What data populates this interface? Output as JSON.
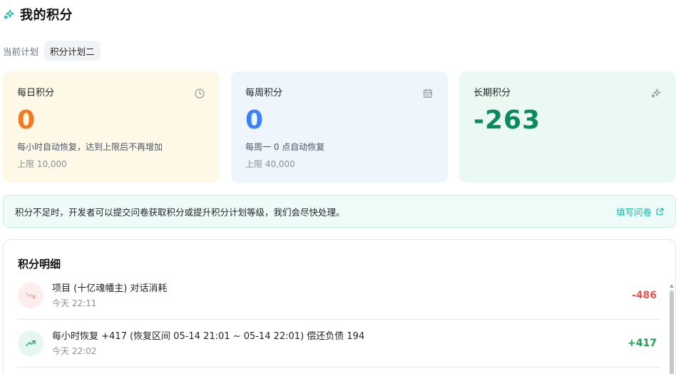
{
  "header": {
    "title": "我的积分",
    "icon": "sparkle-icon"
  },
  "plan": {
    "label": "当前计划",
    "name": "积分计划二"
  },
  "cards": {
    "daily": {
      "title": "每日积分",
      "icon": "clock-icon",
      "value": "0",
      "desc": "每小时自动恢复，达到上限后不再增加",
      "limit": "上限 10,000",
      "color": "#f47a1f"
    },
    "weekly": {
      "title": "每周积分",
      "icon": "calendar-icon",
      "value": "0",
      "desc": "每周一 0 点自动恢复",
      "limit": "上限 40,000",
      "color": "#3b82f6"
    },
    "long": {
      "title": "长期积分",
      "icon": "sparkle-icon",
      "value": "-263",
      "color": "#0b8a5b"
    }
  },
  "notice": {
    "text": "积分不足时，开发者可以提交问卷获取积分或提升积分计划等级，我们会尽快处理。",
    "link": "填写问卷",
    "link_icon": "external-link-icon"
  },
  "detail": {
    "title": "积分明细",
    "rows": [
      {
        "desc": "项目 (十亿魂幡主) 对话消耗",
        "time": "今天 22:11",
        "amount": "-486",
        "icon": "trend-down-icon"
      },
      {
        "desc": "每小时恢复 +417 (恢复区间 05-14 21:01 ~ 05-14 22:01) 偿还负债 194",
        "time": "今天 22:02",
        "amount": "+417",
        "icon": "trend-up-icon"
      }
    ]
  },
  "colors": {
    "accent": "#14b8a6",
    "negative": "#ef5350",
    "positive": "#16a34a"
  }
}
